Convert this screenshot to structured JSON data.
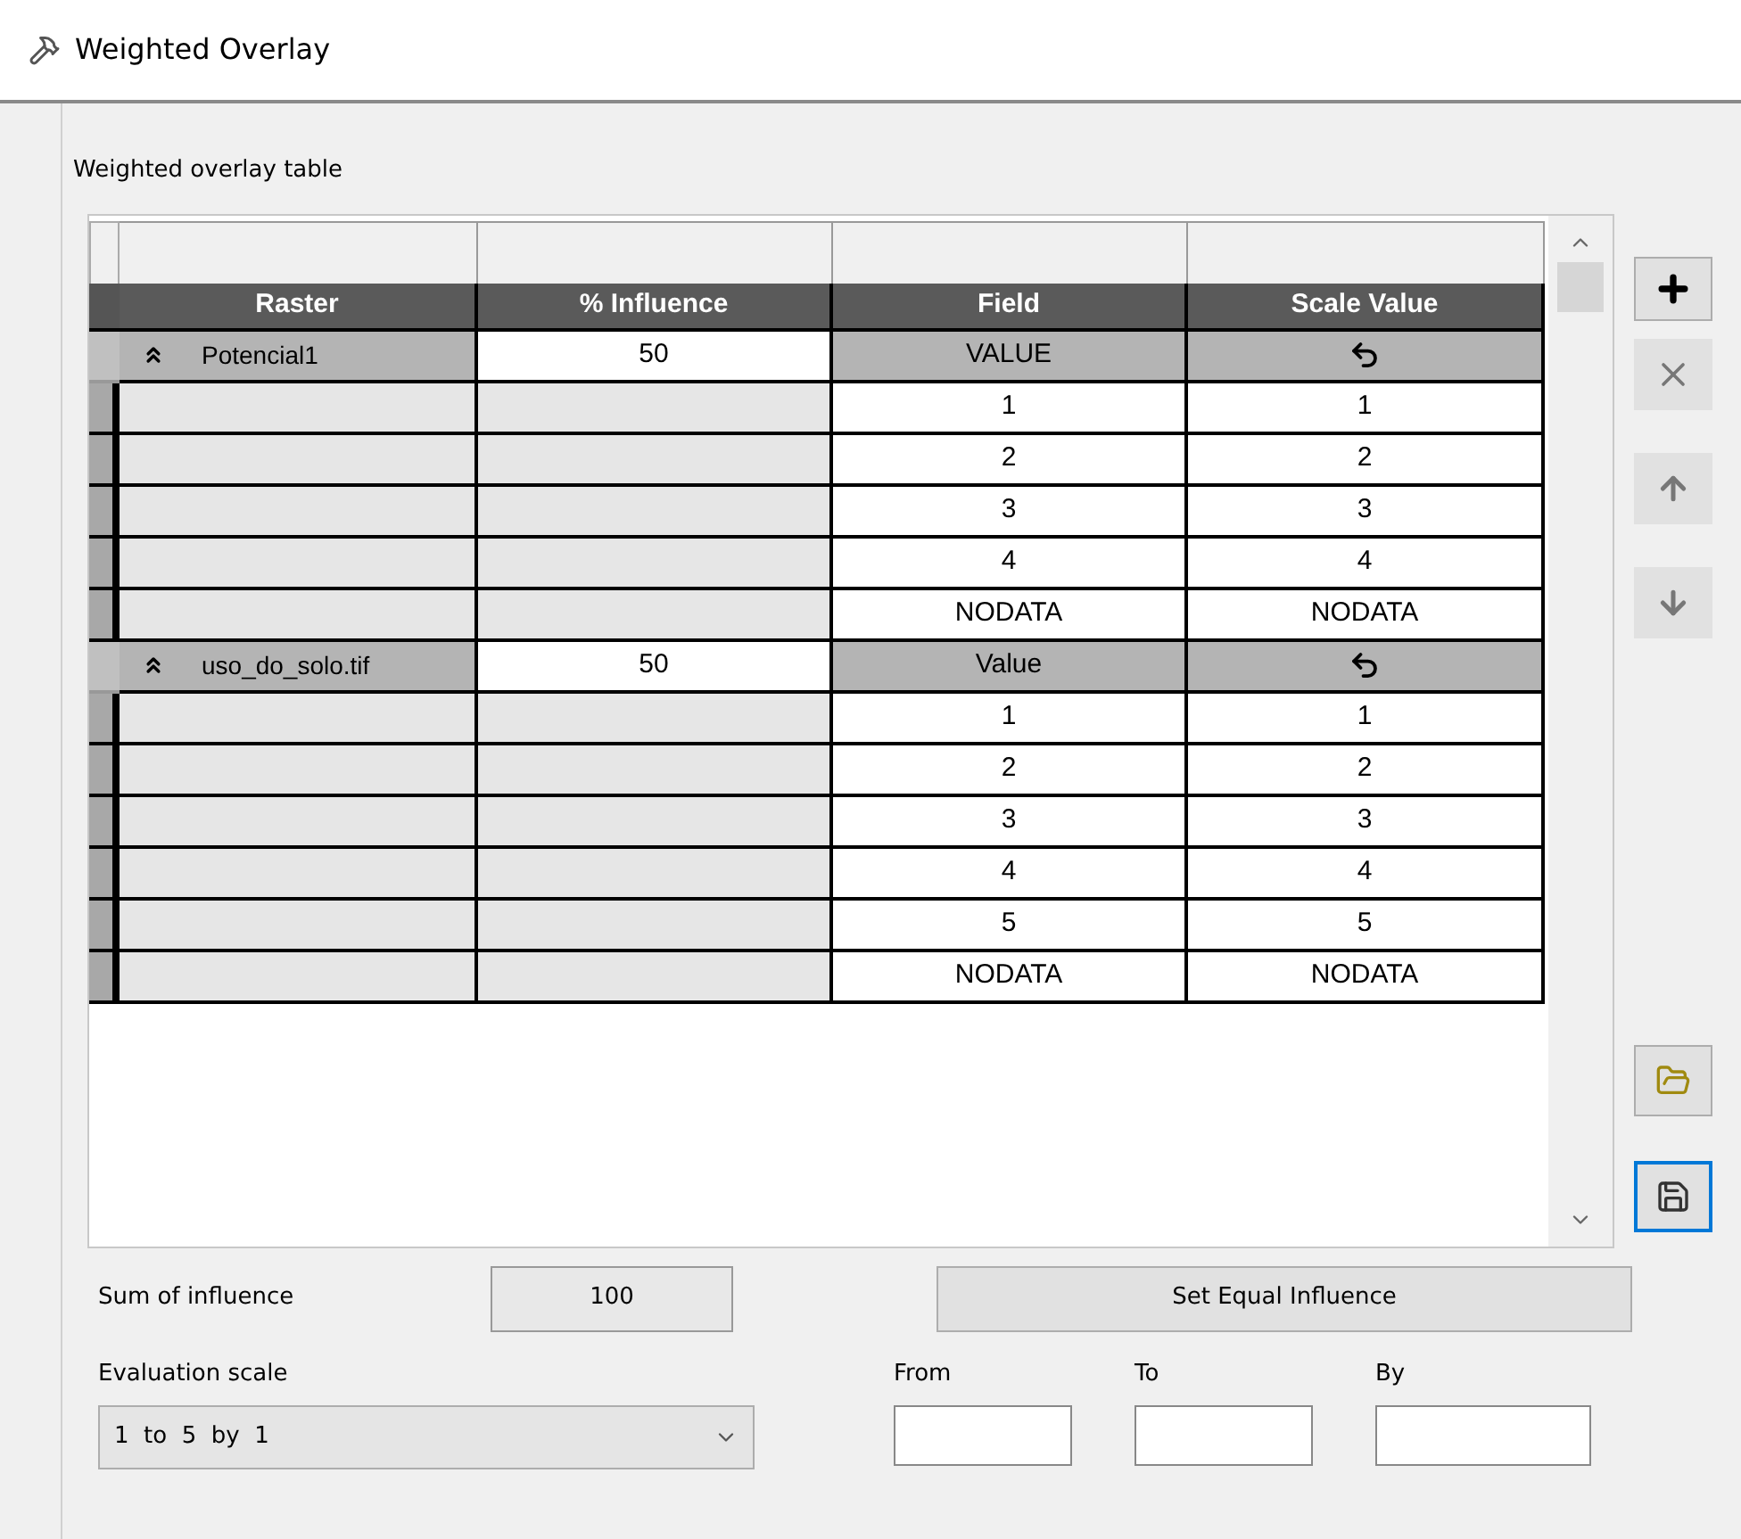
{
  "window": {
    "title": "Weighted Overlay"
  },
  "table": {
    "label": "Weighted overlay table",
    "columns": [
      "Raster",
      "% Influence",
      "Field",
      "Scale Value"
    ],
    "groups": [
      {
        "raster": "Potencial1",
        "influence": "50",
        "field_header": "VALUE",
        "rows": [
          {
            "field": "1",
            "scale": "1"
          },
          {
            "field": "2",
            "scale": "2"
          },
          {
            "field": "3",
            "scale": "3"
          },
          {
            "field": "4",
            "scale": "4"
          },
          {
            "field": "NODATA",
            "scale": "NODATA"
          }
        ]
      },
      {
        "raster": "uso_do_solo.tif",
        "influence": "50",
        "field_header": "Value",
        "rows": [
          {
            "field": "1",
            "scale": "1"
          },
          {
            "field": "2",
            "scale": "2"
          },
          {
            "field": "3",
            "scale": "3"
          },
          {
            "field": "4",
            "scale": "4"
          },
          {
            "field": "5",
            "scale": "5"
          },
          {
            "field": "NODATA",
            "scale": "NODATA"
          }
        ]
      }
    ]
  },
  "sum": {
    "label": "Sum of influence",
    "value": "100"
  },
  "equal_button": "Set Equal Influence",
  "evaluation": {
    "label": "Evaluation scale",
    "value": "1  to  5  by  1"
  },
  "range": [
    {
      "label": "From"
    },
    {
      "label": "To"
    },
    {
      "label": "By"
    }
  ]
}
